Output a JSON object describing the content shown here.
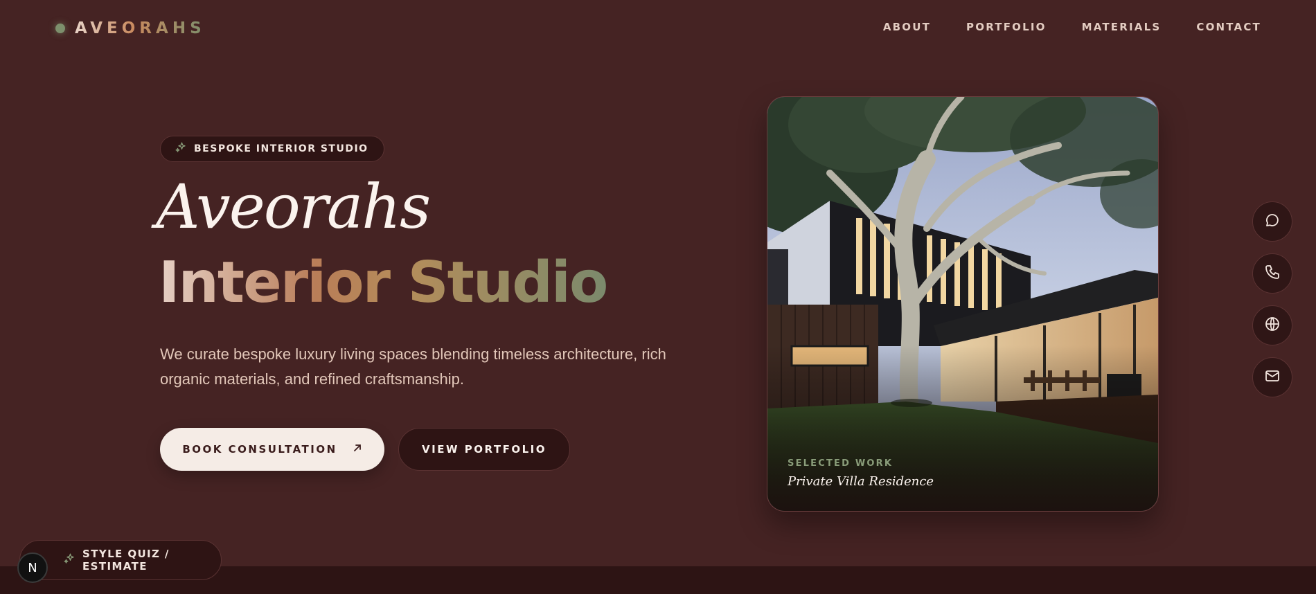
{
  "brand": {
    "name": "AVEORAHS"
  },
  "nav": {
    "items": [
      "ABOUT",
      "PORTFOLIO",
      "MATERIALS",
      "CONTACT"
    ]
  },
  "hero": {
    "badge": "BESPOKE INTERIOR STUDIO",
    "title_line1": "Aveorahs",
    "title_line2": "Interior Studio",
    "description": "We curate bespoke luxury living spaces blending timeless architecture, rich organic materials, and refined craftsmanship.",
    "primary_cta": "BOOK CONSULTATION",
    "secondary_cta": "VIEW PORTFOLIO"
  },
  "card": {
    "kicker": "SELECTED WORK",
    "title": "Private Villa Residence"
  },
  "side_actions": [
    "chat-icon",
    "phone-icon",
    "globe-icon",
    "mail-icon"
  ],
  "quiz": {
    "label": "STYLE QUIZ / ESTIMATE"
  },
  "dev_badge": {
    "letter": "N"
  },
  "colors": {
    "background": "#452323",
    "accent_green": "#7d8f6c",
    "accent_copper": "#b97d58",
    "cream": "#f5ece6",
    "dark_panel": "#2e1414"
  }
}
